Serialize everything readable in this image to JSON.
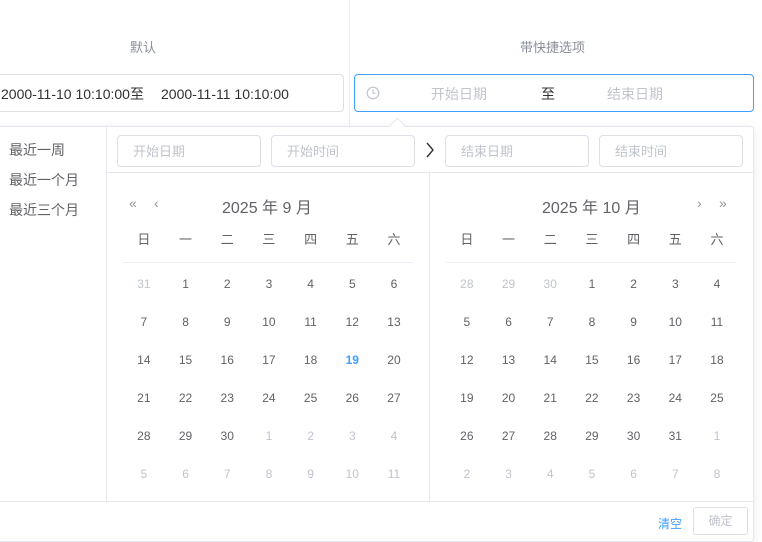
{
  "sections": {
    "default_title": "默认",
    "shortcut_title": "带快捷选项"
  },
  "default_range": {
    "start": "2000-11-10 10:10:00",
    "separator": "至",
    "end": "2000-11-11 10:10:00"
  },
  "shortcut_range": {
    "icon": "clock-icon",
    "start_placeholder": "开始日期",
    "separator": "至",
    "end_placeholder": "结束日期"
  },
  "shortcuts": [
    "最近一周",
    "最近一个月",
    "最近三个月"
  ],
  "picker_inputs": {
    "start_date": "开始日期",
    "start_time": "开始时间",
    "arrow": "›",
    "end_date": "结束日期",
    "end_time": "结束时间"
  },
  "weekdays": [
    "日",
    "一",
    "二",
    "三",
    "四",
    "五",
    "六"
  ],
  "left_calendar": {
    "title": "2025 年 9 月",
    "days": [
      {
        "d": "31",
        "m": 1
      },
      {
        "d": "1"
      },
      {
        "d": "2"
      },
      {
        "d": "3"
      },
      {
        "d": "4"
      },
      {
        "d": "5"
      },
      {
        "d": "6"
      },
      {
        "d": "7"
      },
      {
        "d": "8"
      },
      {
        "d": "9"
      },
      {
        "d": "10"
      },
      {
        "d": "11"
      },
      {
        "d": "12"
      },
      {
        "d": "13"
      },
      {
        "d": "14"
      },
      {
        "d": "15"
      },
      {
        "d": "16"
      },
      {
        "d": "17"
      },
      {
        "d": "18"
      },
      {
        "d": "19",
        "t": 1
      },
      {
        "d": "20"
      },
      {
        "d": "21"
      },
      {
        "d": "22"
      },
      {
        "d": "23"
      },
      {
        "d": "24"
      },
      {
        "d": "25"
      },
      {
        "d": "26"
      },
      {
        "d": "27"
      },
      {
        "d": "28"
      },
      {
        "d": "29"
      },
      {
        "d": "30"
      },
      {
        "d": "1",
        "m": 1
      },
      {
        "d": "2",
        "m": 1
      },
      {
        "d": "3",
        "m": 1
      },
      {
        "d": "4",
        "m": 1
      },
      {
        "d": "5",
        "m": 1
      },
      {
        "d": "6",
        "m": 1
      },
      {
        "d": "7",
        "m": 1
      },
      {
        "d": "8",
        "m": 1
      },
      {
        "d": "9",
        "m": 1
      },
      {
        "d": "10",
        "m": 1
      },
      {
        "d": "11",
        "m": 1
      }
    ]
  },
  "right_calendar": {
    "title": "2025 年 10 月",
    "days": [
      {
        "d": "28",
        "m": 1
      },
      {
        "d": "29",
        "m": 1
      },
      {
        "d": "30",
        "m": 1
      },
      {
        "d": "1"
      },
      {
        "d": "2"
      },
      {
        "d": "3"
      },
      {
        "d": "4"
      },
      {
        "d": "5"
      },
      {
        "d": "6"
      },
      {
        "d": "7"
      },
      {
        "d": "8"
      },
      {
        "d": "9"
      },
      {
        "d": "10"
      },
      {
        "d": "11"
      },
      {
        "d": "12"
      },
      {
        "d": "13"
      },
      {
        "d": "14"
      },
      {
        "d": "15"
      },
      {
        "d": "16"
      },
      {
        "d": "17"
      },
      {
        "d": "18"
      },
      {
        "d": "19"
      },
      {
        "d": "20"
      },
      {
        "d": "21"
      },
      {
        "d": "22"
      },
      {
        "d": "23"
      },
      {
        "d": "24"
      },
      {
        "d": "25"
      },
      {
        "d": "26"
      },
      {
        "d": "27"
      },
      {
        "d": "28"
      },
      {
        "d": "29"
      },
      {
        "d": "30"
      },
      {
        "d": "31"
      },
      {
        "d": "1",
        "m": 1
      },
      {
        "d": "2",
        "m": 1
      },
      {
        "d": "3",
        "m": 1
      },
      {
        "d": "4",
        "m": 1
      },
      {
        "d": "5",
        "m": 1
      },
      {
        "d": "6",
        "m": 1
      },
      {
        "d": "7",
        "m": 1
      },
      {
        "d": "8",
        "m": 1
      }
    ]
  },
  "nav": {
    "prev_year": "«",
    "prev_month": "‹",
    "next_month": "›",
    "next_year": "»"
  },
  "footer": {
    "clear": "清空",
    "confirm": "确定"
  },
  "colors": {
    "accent": "#409eff",
    "muted": "#c0c4cc",
    "text": "#606266"
  }
}
